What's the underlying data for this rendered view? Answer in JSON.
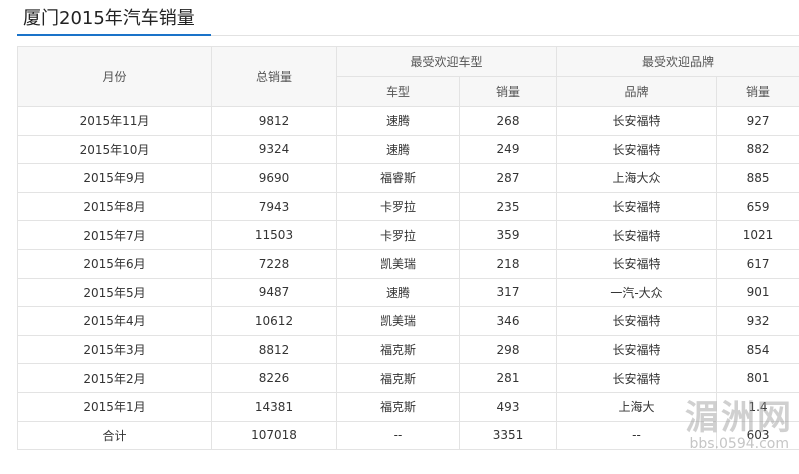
{
  "page": {
    "title": "厦门2015年汽车销量"
  },
  "table": {
    "header": {
      "month": "月份",
      "total": "总销量",
      "popular_model_group": "最受欢迎车型",
      "popular_brand_group": "最受欢迎品牌",
      "model": "车型",
      "model_sales": "销量",
      "brand": "品牌",
      "brand_sales": "销量"
    },
    "rows": [
      {
        "month": "2015年11月",
        "total": "9812",
        "model": "速腾",
        "model_sales": "268",
        "brand": "长安福特",
        "brand_sales": "927"
      },
      {
        "month": "2015年10月",
        "total": "9324",
        "model": "速腾",
        "model_sales": "249",
        "brand": "长安福特",
        "brand_sales": "882"
      },
      {
        "month": "2015年9月",
        "total": "9690",
        "model": "福睿斯",
        "model_sales": "287",
        "brand": "上海大众",
        "brand_sales": "885"
      },
      {
        "month": "2015年8月",
        "total": "7943",
        "model": "卡罗拉",
        "model_sales": "235",
        "brand": "长安福特",
        "brand_sales": "659"
      },
      {
        "month": "2015年7月",
        "total": "11503",
        "model": "卡罗拉",
        "model_sales": "359",
        "brand": "长安福特",
        "brand_sales": "1021"
      },
      {
        "month": "2015年6月",
        "total": "7228",
        "model": "凯美瑞",
        "model_sales": "218",
        "brand": "长安福特",
        "brand_sales": "617"
      },
      {
        "month": "2015年5月",
        "total": "9487",
        "model": "速腾",
        "model_sales": "317",
        "brand": "一汽-大众",
        "brand_sales": "901"
      },
      {
        "month": "2015年4月",
        "total": "10612",
        "model": "凯美瑞",
        "model_sales": "346",
        "brand": "长安福特",
        "brand_sales": "932"
      },
      {
        "month": "2015年3月",
        "total": "8812",
        "model": "福克斯",
        "model_sales": "298",
        "brand": "长安福特",
        "brand_sales": "854"
      },
      {
        "month": "2015年2月",
        "total": "8226",
        "model": "福克斯",
        "model_sales": "281",
        "brand": "长安福特",
        "brand_sales": "801"
      },
      {
        "month": "2015年1月",
        "total": "14381",
        "model": "福克斯",
        "model_sales": "493",
        "brand": "上海大",
        "brand_sales": "1.4"
      },
      {
        "month": "合计",
        "total": "107018",
        "model": "--",
        "model_sales": "3351",
        "brand": "--",
        "brand_sales": "603"
      }
    ]
  },
  "watermark": {
    "name": "湄洲网",
    "url": "bbs.0594.com"
  }
}
